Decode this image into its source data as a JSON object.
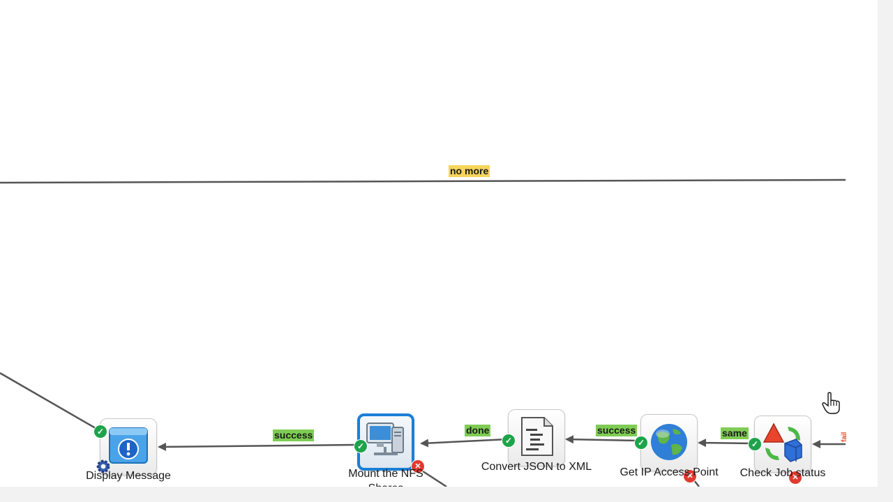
{
  "connections": {
    "no_more": "no more",
    "success_1": "success",
    "done": "done",
    "success_2": "success",
    "same": "same",
    "fail_partial": "fail"
  },
  "nodes": {
    "display_message": "Display Message",
    "mount_nfs": "Mount the NFS Shares",
    "convert_json": "Convert JSON to XML",
    "get_ip": "Get IP Access Point",
    "check_job": "Check Job status"
  },
  "colors": {
    "success_label": "#7fcc55",
    "warning_label": "#f4d45a",
    "selected_border": "#1a7fd6",
    "ok_badge": "#1ea34a",
    "error_badge": "#e23a2e"
  }
}
